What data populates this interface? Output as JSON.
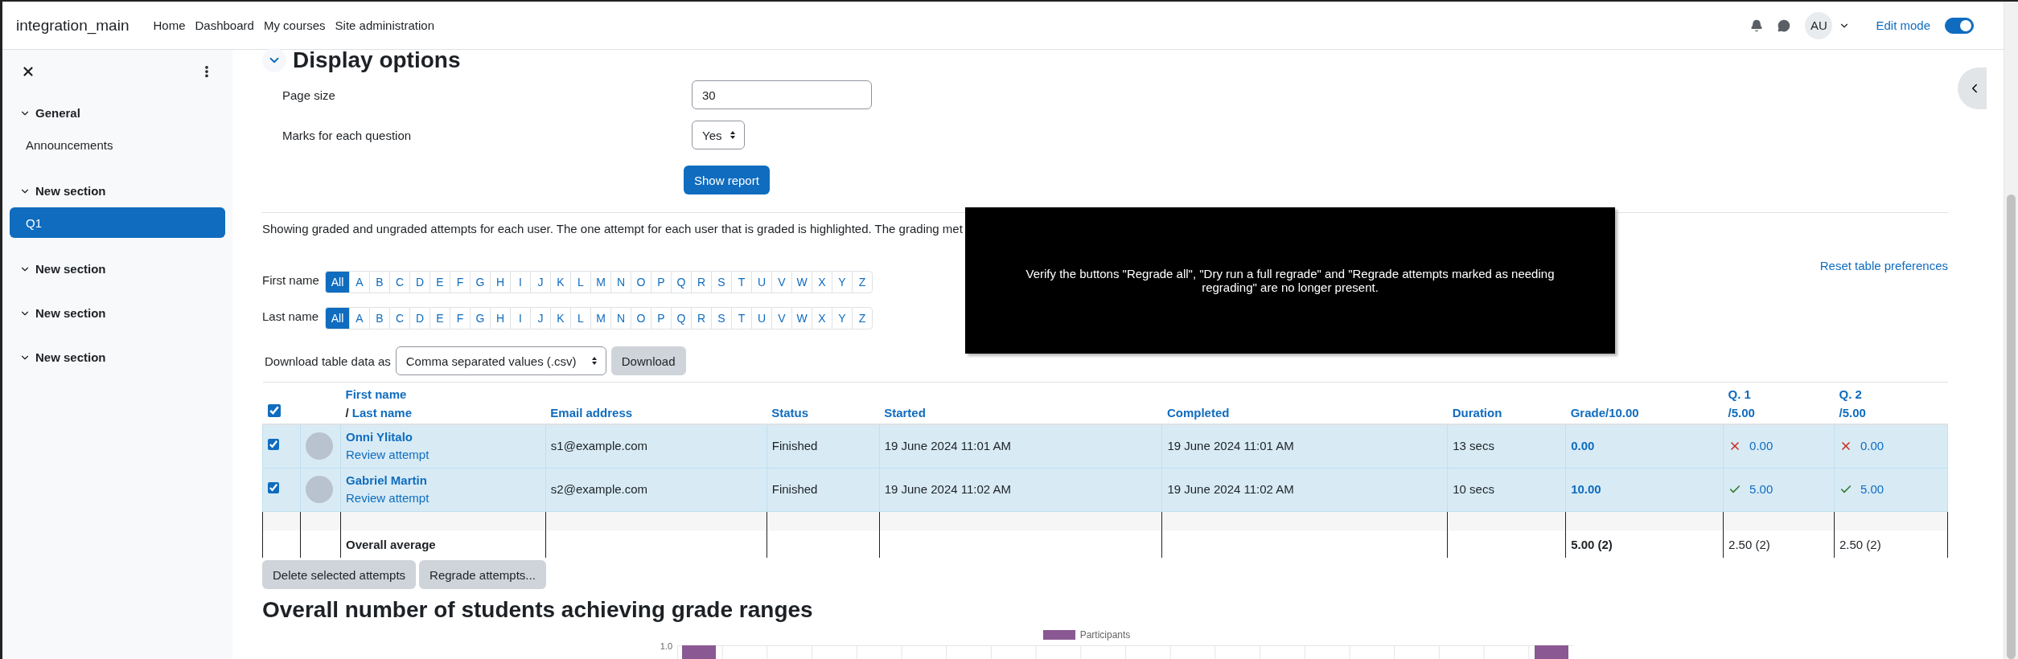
{
  "navbar": {
    "site_name": "integration_main",
    "links": [
      "Home",
      "Dashboard",
      "My courses",
      "Site administration"
    ],
    "user_initials": "AU",
    "edit_mode": {
      "label": "Edit mode",
      "on": true
    }
  },
  "drawer": {
    "sections": [
      {
        "title": "General",
        "expanded": true,
        "items": [
          {
            "label": "Announcements",
            "selected": false
          }
        ]
      },
      {
        "title": "New section",
        "expanded": true,
        "items": [
          {
            "label": "Q1",
            "selected": true
          }
        ]
      },
      {
        "title": "New section",
        "expanded": true
      },
      {
        "title": "New section",
        "expanded": true
      },
      {
        "title": "New section",
        "expanded": true
      }
    ]
  },
  "display_options": {
    "title": "Display options",
    "expanded": true,
    "fields": [
      {
        "kind": "text",
        "label": "Page size",
        "value": "30"
      },
      {
        "kind": "select",
        "label": "Marks for each question",
        "value": "Yes"
      }
    ],
    "submit": "Show report"
  },
  "report": {
    "description": "Showing graded and ungraded attempts for each user. The one attempt for each user that is graded is highlighted. The grading met",
    "reset_link": "Reset table preferences",
    "initials_bars": [
      {
        "label": "First name",
        "letters": [
          {
            "letter": "All",
            "selected": true
          },
          {
            "letter": "A",
            "selected": false
          },
          {
            "letter": "B",
            "selected": false
          },
          {
            "letter": "C",
            "selected": false
          },
          {
            "letter": "D",
            "selected": false
          },
          {
            "letter": "E",
            "selected": false
          },
          {
            "letter": "F",
            "selected": false
          },
          {
            "letter": "G",
            "selected": false
          },
          {
            "letter": "H",
            "selected": false
          },
          {
            "letter": "I",
            "selected": false
          },
          {
            "letter": "J",
            "selected": false
          },
          {
            "letter": "K",
            "selected": false
          },
          {
            "letter": "L",
            "selected": false
          },
          {
            "letter": "M",
            "selected": false
          },
          {
            "letter": "N",
            "selected": false
          },
          {
            "letter": "O",
            "selected": false
          },
          {
            "letter": "P",
            "selected": false
          },
          {
            "letter": "Q",
            "selected": false
          },
          {
            "letter": "R",
            "selected": false
          },
          {
            "letter": "S",
            "selected": false
          },
          {
            "letter": "T",
            "selected": false
          },
          {
            "letter": "U",
            "selected": false
          },
          {
            "letter": "V",
            "selected": false
          },
          {
            "letter": "W",
            "selected": false
          },
          {
            "letter": "X",
            "selected": false
          },
          {
            "letter": "Y",
            "selected": false
          },
          {
            "letter": "Z",
            "selected": false
          }
        ]
      },
      {
        "label": "Last name",
        "letters": [
          {
            "letter": "All",
            "selected": true
          },
          {
            "letter": "A",
            "selected": false
          },
          {
            "letter": "B",
            "selected": false
          },
          {
            "letter": "C",
            "selected": false
          },
          {
            "letter": "D",
            "selected": false
          },
          {
            "letter": "E",
            "selected": false
          },
          {
            "letter": "F",
            "selected": false
          },
          {
            "letter": "G",
            "selected": false
          },
          {
            "letter": "H",
            "selected": false
          },
          {
            "letter": "I",
            "selected": false
          },
          {
            "letter": "J",
            "selected": false
          },
          {
            "letter": "K",
            "selected": false
          },
          {
            "letter": "L",
            "selected": false
          },
          {
            "letter": "M",
            "selected": false
          },
          {
            "letter": "N",
            "selected": false
          },
          {
            "letter": "O",
            "selected": false
          },
          {
            "letter": "P",
            "selected": false
          },
          {
            "letter": "Q",
            "selected": false
          },
          {
            "letter": "R",
            "selected": false
          },
          {
            "letter": "S",
            "selected": false
          },
          {
            "letter": "T",
            "selected": false
          },
          {
            "letter": "U",
            "selected": false
          },
          {
            "letter": "V",
            "selected": false
          },
          {
            "letter": "W",
            "selected": false
          },
          {
            "letter": "X",
            "selected": false
          },
          {
            "letter": "Y",
            "selected": false
          },
          {
            "letter": "Z",
            "selected": false
          }
        ]
      }
    ],
    "download": {
      "label": "Download table data as",
      "format": "Comma separated values (.csv)",
      "button": "Download"
    }
  },
  "table": {
    "select_all_checked": true,
    "columns": [
      {
        "kind": "name",
        "first": "First name",
        "separator": "/",
        "second": "Last name"
      },
      {
        "kind": "plain",
        "label": "Email address"
      },
      {
        "kind": "plain",
        "label": "Status"
      },
      {
        "kind": "plain",
        "label": "Started"
      },
      {
        "kind": "plain",
        "label": "Completed"
      },
      {
        "kind": "plain",
        "label": "Duration"
      },
      {
        "kind": "plain",
        "label": "Grade/10.00"
      },
      {
        "kind": "question",
        "label": "Q. 1",
        "max": "/5.00"
      },
      {
        "kind": "question",
        "label": "Q. 2",
        "max": "/5.00"
      }
    ],
    "rows": [
      {
        "checked": true,
        "highlighted": true,
        "name": "Onni Ylitalo",
        "review": "Review attempt",
        "email": "s1@example.com",
        "status": "Finished",
        "started": "19 June 2024 11:01 AM",
        "completed": "19 June 2024 11:01 AM",
        "duration": "13 secs",
        "grade": "0.00",
        "questions": [
          {
            "correct": false,
            "value": "0.00"
          },
          {
            "correct": false,
            "value": "0.00"
          }
        ]
      },
      {
        "checked": true,
        "highlighted": true,
        "name": "Gabriel Martin",
        "review": "Review attempt",
        "email": "s2@example.com",
        "status": "Finished",
        "started": "19 June 2024 11:02 AM",
        "completed": "19 June 2024 11:02 AM",
        "duration": "10 secs",
        "grade": "10.00",
        "questions": [
          {
            "correct": true,
            "value": "5.00"
          },
          {
            "correct": true,
            "value": "5.00"
          }
        ]
      }
    ],
    "average": {
      "label": "Overall average",
      "grade": "5.00 (2)",
      "questions": [
        "2.50 (2)",
        "2.50 (2)"
      ]
    }
  },
  "bulk_actions": [
    "Delete selected attempts",
    "Regrade attempts..."
  ],
  "chart": {
    "title": "Overall number of students achieving grade ranges",
    "legend": "Participants",
    "y_tick": "1.0"
  },
  "overlay": {
    "text": "Verify the buttons \"Regrade all\", \"Dry run a full regrade\" and \"Regrade attempts marked as needing regrading\" are no longer present."
  }
}
